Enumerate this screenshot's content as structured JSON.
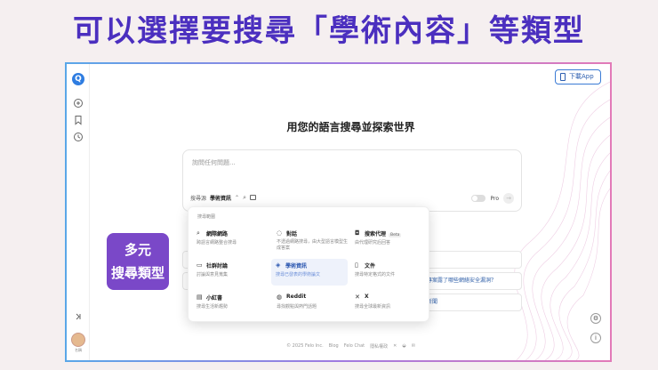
{
  "promo_title": "可以選擇要搜尋「學術內容」等類型",
  "sticker": {
    "line1": "多元",
    "line2": "搜尋類型"
  },
  "rail": {
    "logo_letter": "Q",
    "avatar_label": "名稱"
  },
  "download_label": "下載App",
  "headline": "用您的語言搜尋並探索世界",
  "search": {
    "placeholder": "詢問任何問題...",
    "scope_prefix": "搜尋源",
    "scope_value": "學術資訊",
    "pro_label": "Pro"
  },
  "bg_questions": [
    "",
    "",
    "專案露了哪些網絡安全漏洞？",
    "新聞"
  ],
  "dropdown": {
    "title": "搜尋範圍",
    "items": [
      {
        "icon": "search-icon",
        "label": "網際網路",
        "desc": "跨語言網路整合搜尋",
        "active": false,
        "badge": ""
      },
      {
        "icon": "chat-icon",
        "label": "對話",
        "desc": "不透過網路搜尋，由大型語言模型生成答案",
        "active": false,
        "badge": ""
      },
      {
        "icon": "robot-icon",
        "label": "搜索代理",
        "desc": "由代理研究后回答",
        "active": false,
        "badge": "Beta"
      },
      {
        "icon": "comment-icon",
        "label": "社群討論",
        "desc": "討論與意見蒐集",
        "active": false,
        "badge": ""
      },
      {
        "icon": "graduation-cap-icon",
        "label": "學術資訊",
        "desc": "搜尋已發表的學術論文",
        "active": true,
        "badge": ""
      },
      {
        "icon": "document-icon",
        "label": "文件",
        "desc": "搜尋特定格式的文件",
        "active": false,
        "badge": ""
      },
      {
        "icon": "book-icon",
        "label": "小紅書",
        "desc": "搜尋生活新趨勢",
        "active": false,
        "badge": ""
      },
      {
        "icon": "reddit-icon",
        "label": "Reddit",
        "desc": "尋找觀點與熱門話題",
        "active": false,
        "badge": ""
      },
      {
        "icon": "x-logo-icon",
        "label": "X",
        "desc": "搜尋全球最新資訊",
        "active": false,
        "badge": ""
      }
    ]
  },
  "footer": {
    "copyright": "© 2025 Felo Inc.",
    "links": [
      "Blog",
      "Felo Chat",
      "隱私權政"
    ]
  },
  "colors": {
    "accent": "#4b2fbf",
    "sticker": "#7a48c8",
    "link": "#2f5fa8"
  }
}
